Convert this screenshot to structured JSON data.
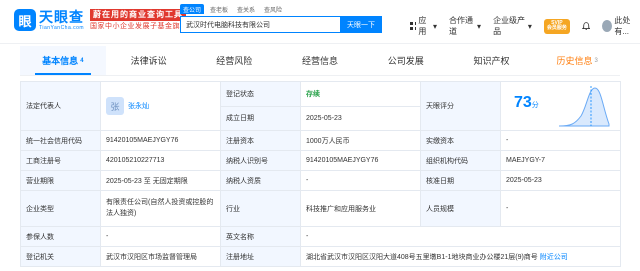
{
  "logo": {
    "mark": "眼",
    "name": "天眼查",
    "sub": "TianYanCha.com"
  },
  "slogan": {
    "line1": "蔚在用的商业查询工具",
    "line2": "国家中小企业发展子基金旗下机构"
  },
  "search": {
    "tabs": [
      "查公司",
      "查老板",
      "查关系",
      "查风险"
    ],
    "value": "武汉时代电脑科技有限公司",
    "button": "天眼一下"
  },
  "topnav": {
    "items": [
      "应用",
      "合作通道",
      "企业级产品"
    ],
    "vip_label": "SVIP\n会员服务",
    "user": "此处有..."
  },
  "tabs": [
    {
      "label": "基本信息",
      "count": "4"
    },
    {
      "label": "法律诉讼",
      "count": ""
    },
    {
      "label": "经营风险",
      "count": ""
    },
    {
      "label": "经营信息",
      "count": ""
    },
    {
      "label": "公司发展",
      "count": ""
    },
    {
      "label": "知识产权",
      "count": ""
    },
    {
      "label": "历史信息",
      "count": "3"
    }
  ],
  "info": {
    "legal_rep_label": "法定代表人",
    "legal_rep_avatar": "张",
    "legal_rep_name": "张永灿",
    "reg_status_label": "登记状态",
    "reg_status_pill": "小程",
    "reg_status": "存续",
    "score_label": "天眼评分",
    "score": "73",
    "score_unit": "分",
    "est_date_label": "成立日期",
    "est_date": "2025-05-23",
    "credit_code_label": "统一社会信用代码",
    "credit_code": "91420105MAEJYGY76",
    "reg_capital_label": "注册资本",
    "reg_capital": "1000万人民币",
    "paid_capital_label": "实缴资本",
    "paid_capital": "-",
    "reg_no_label": "工商注册号",
    "reg_no": "420105210227713",
    "tax_id_label": "纳税人识别号",
    "tax_id": "91420105MAEJYGY76",
    "org_code_label": "组织机构代码",
    "org_code": "MAEJYGY-7",
    "term_label": "营业期限",
    "term": "2025-05-23 至 无固定期限",
    "taxpayer_q_label": "纳税人资质",
    "taxpayer_q": "-",
    "approval_label": "核准日期",
    "approval": "2025-05-23",
    "type_label": "企业类型",
    "type": "有限责任公司(自然人投资或控股的法人独资)",
    "industry_label": "行业",
    "industry": "科技推广和应用服务业",
    "staff_label": "人员规模",
    "staff": "-",
    "insured_label": "参保人数",
    "insured": "-",
    "en_name_label": "英文名称",
    "en_name": "-",
    "authority_label": "登记机关",
    "authority": "武汉市汉阳区市场监督管理局",
    "address_label": "注册地址",
    "address": "湖北省武汉市汉阳区汉阳大道408号五里墩B1-1地块商业办公楼21层(9)商号",
    "address_link": "附近公司"
  },
  "colors": {
    "brand": "#0084ff",
    "accent": "#e0382e",
    "header_bg": "#f2f7ff",
    "status_green": "#2ea44f"
  }
}
